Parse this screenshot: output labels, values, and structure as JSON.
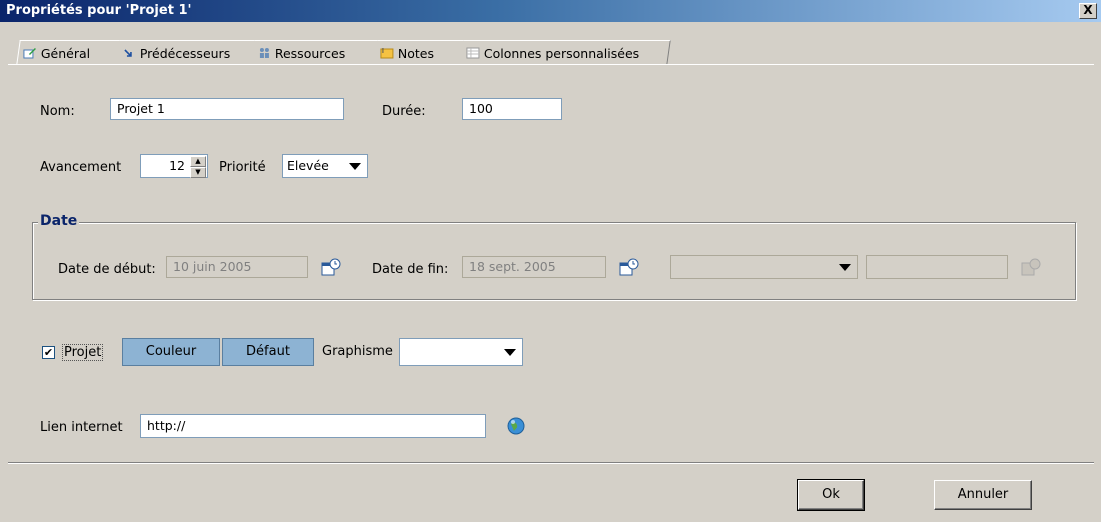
{
  "window": {
    "title": "Propriétés pour 'Projet 1'",
    "close_label": "X"
  },
  "tabs": [
    {
      "label": "Général",
      "icon": "edit-icon",
      "active": true
    },
    {
      "label": "Prédécesseurs",
      "icon": "arrow-icon"
    },
    {
      "label": "Ressources",
      "icon": "people-icon"
    },
    {
      "label": "Notes",
      "icon": "notes-icon"
    },
    {
      "label": "Colonnes personnalisées",
      "icon": "table-icon"
    }
  ],
  "general": {
    "name_label": "Nom:",
    "name_value": "Projet 1",
    "duration_label": "Durée:",
    "duration_value": "100",
    "progress_label": "Avancement",
    "progress_value": "12",
    "priority_label": "Priorité",
    "priority_value": "Elevée"
  },
  "date": {
    "legend": "Date",
    "start_label": "Date de début:",
    "start_value": "10 juin 2005",
    "end_label": "Date de fin:",
    "end_value": "18 sept. 2005",
    "extra_combo_value": "",
    "extra_field_value": ""
  },
  "style": {
    "project_checkbox_label": "Projet",
    "project_checked": true,
    "color_button": "Couleur",
    "default_button": "Défaut",
    "shape_label": "Graphisme",
    "shape_value": ""
  },
  "web": {
    "label": "Lien internet",
    "value": "http://"
  },
  "footer": {
    "ok_label": "Ok",
    "cancel_label": "Annuler"
  },
  "colors": {
    "title_start": "#0a246a",
    "title_end": "#a6caf0",
    "button_blue": "#8db3d3",
    "legend": "#0a246a"
  }
}
